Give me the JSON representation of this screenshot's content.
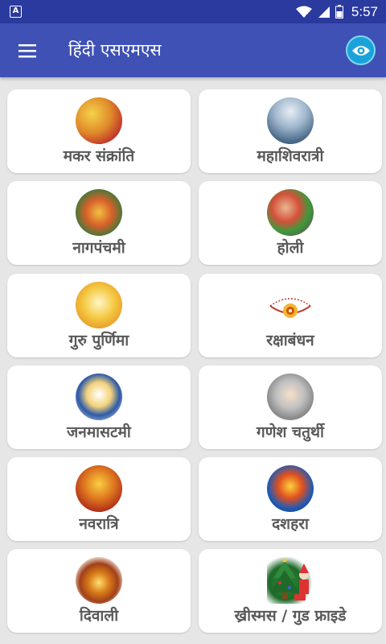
{
  "status_bar": {
    "app_icon": "A",
    "time": "5:57",
    "icons": [
      "wifi-icon",
      "signal-icon",
      "battery-icon"
    ]
  },
  "app_bar": {
    "title": "हिंदी एसएमएस",
    "menu_icon": "hamburger-menu-icon",
    "action_icon": "eye-icon",
    "colors": {
      "primary": "#3f51b5",
      "status": "#2a3a9e",
      "action": "#1aa3d9"
    }
  },
  "categories": [
    {
      "label": "मकर संक्रांति",
      "icon": "kite-festival-icon"
    },
    {
      "label": "महाशिवरात्री",
      "icon": "shiva-icon"
    },
    {
      "label": "नागपंचमी",
      "icon": "snake-festival-icon"
    },
    {
      "label": "होली",
      "icon": "holi-colors-icon"
    },
    {
      "label": "गुरु पुर्णिमा",
      "icon": "guru-icon"
    },
    {
      "label": "रक्षाबंधन",
      "icon": "rakhi-icon"
    },
    {
      "label": "जनमासटमी",
      "icon": "krishna-icon"
    },
    {
      "label": "गणेश चतुर्थी",
      "icon": "ganesha-icon"
    },
    {
      "label": "नवरात्रि",
      "icon": "durga-icon"
    },
    {
      "label": "दशहरा",
      "icon": "ravana-icon"
    },
    {
      "label": "दिवाली",
      "icon": "diya-lamps-icon"
    },
    {
      "label": "ख्रीस्मस / गुड फ्राइडे",
      "icon": "christmas-tree-icon"
    }
  ]
}
